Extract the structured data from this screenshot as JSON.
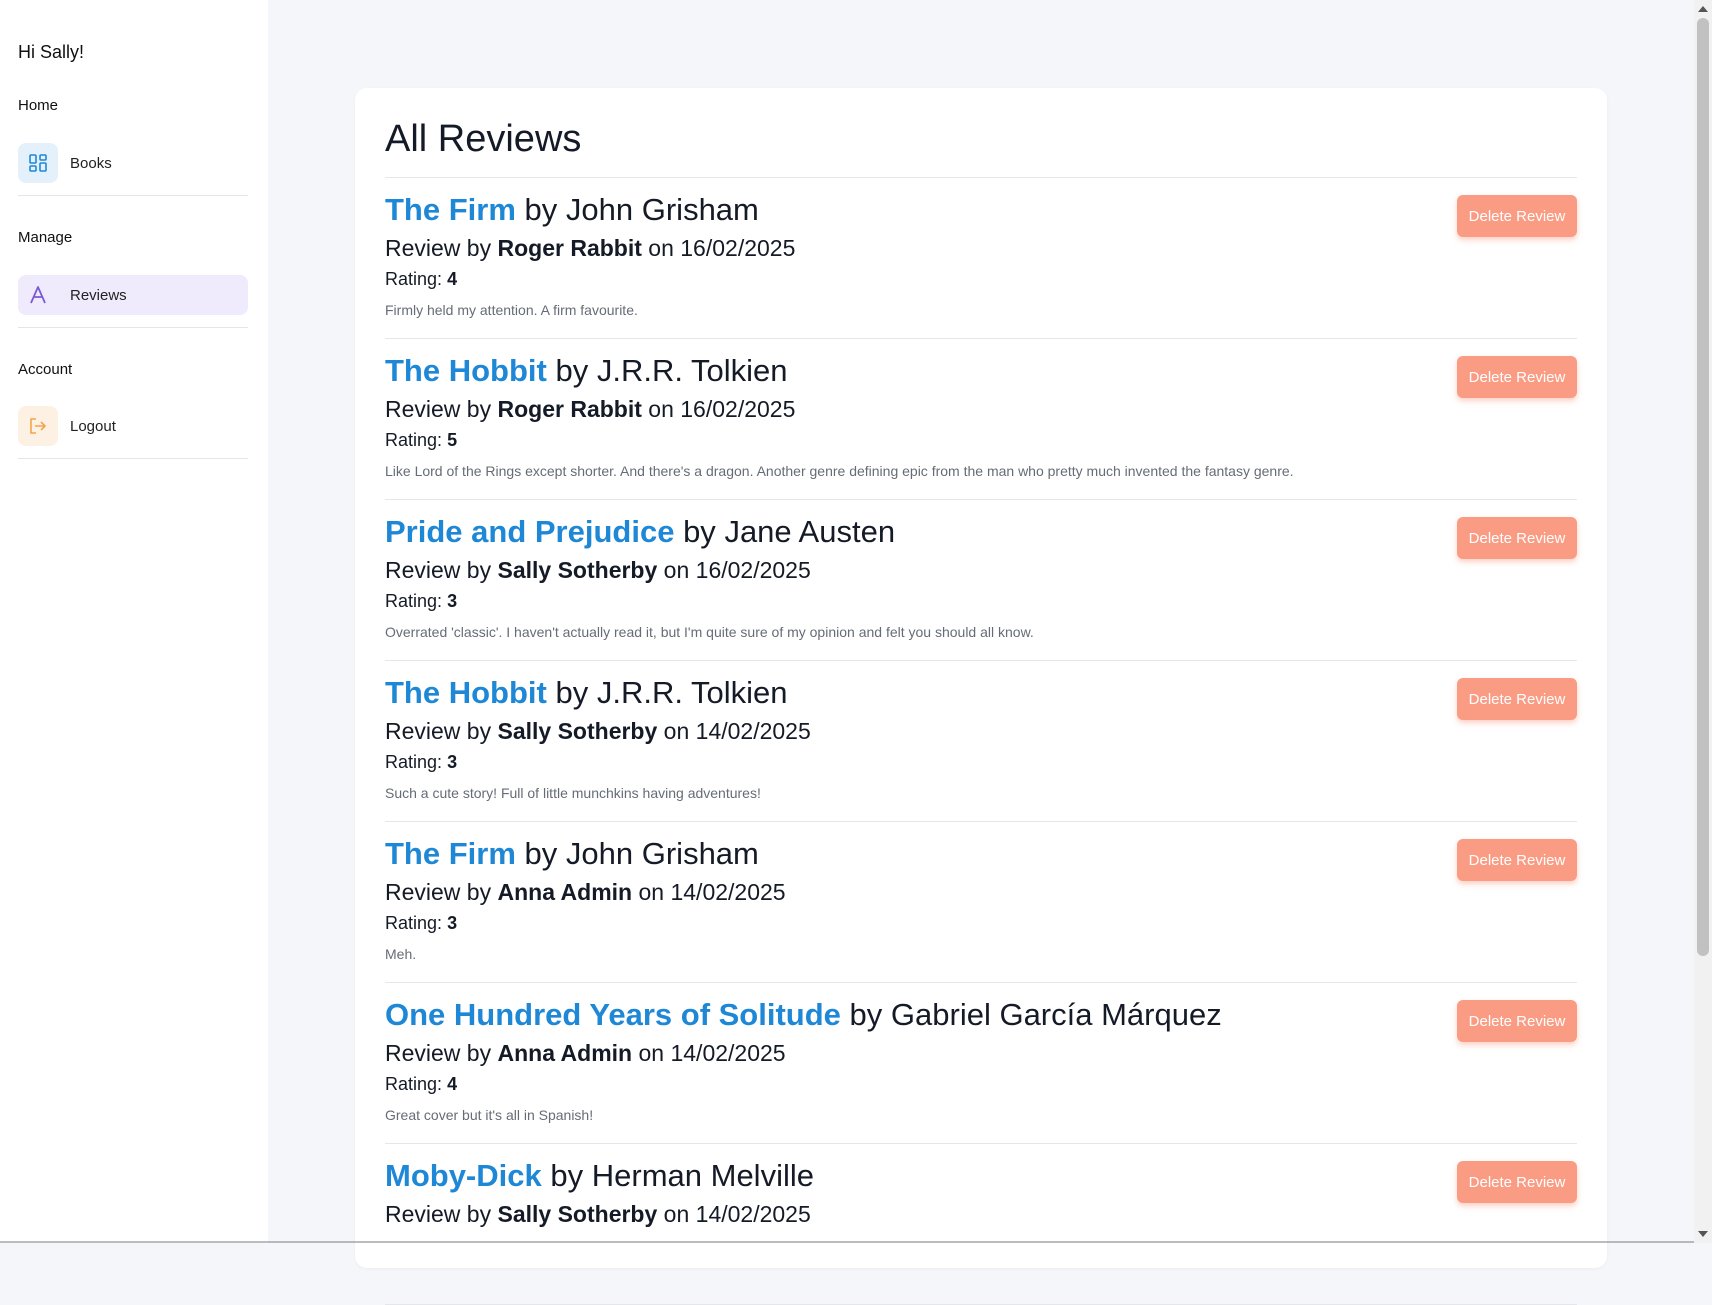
{
  "sidebar": {
    "greeting": "Hi Sally!",
    "home_label": "Home",
    "books_label": "Books",
    "manage_label": "Manage",
    "reviews_label": "Reviews",
    "account_label": "Account",
    "logout_label": "Logout",
    "icons": {
      "books": "dashboard-grid-icon",
      "reviews": "letter-a-icon",
      "logout": "logout-icon"
    }
  },
  "main": {
    "title": "All Reviews",
    "delete_label": "Delete Review",
    "review_by_prefix": "Review by",
    "on_word": "on",
    "rating_prefix": "Rating:",
    "by_word": "by",
    "reviews": [
      {
        "title": "The Firm",
        "author": "John Grisham",
        "reviewer": "Roger Rabbit",
        "date": "16/02/2025",
        "rating": "4",
        "text": "Firmly held my attention. A firm favourite."
      },
      {
        "title": "The Hobbit",
        "author": "J.R.R. Tolkien",
        "reviewer": "Roger Rabbit",
        "date": "16/02/2025",
        "rating": "5",
        "text": "Like Lord of the Rings except shorter. And there's a dragon. Another genre defining epic from the man who pretty much invented the fantasy genre."
      },
      {
        "title": "Pride and Prejudice",
        "author": "Jane Austen",
        "reviewer": "Sally Sotherby",
        "date": "16/02/2025",
        "rating": "3",
        "text": "Overrated 'classic'. I haven't actually read it, but I'm quite sure of my opinion and felt you should all know."
      },
      {
        "title": "The Hobbit",
        "author": "J.R.R. Tolkien",
        "reviewer": "Sally Sotherby",
        "date": "14/02/2025",
        "rating": "3",
        "text": "Such a cute story! Full of little munchkins having adventures!"
      },
      {
        "title": "The Firm",
        "author": "John Grisham",
        "reviewer": "Anna Admin",
        "date": "14/02/2025",
        "rating": "3",
        "text": "Meh."
      },
      {
        "title": "One Hundred Years of Solitude",
        "author": "Gabriel García Márquez",
        "reviewer": "Anna Admin",
        "date": "14/02/2025",
        "rating": "4",
        "text": "Great cover but it's all in Spanish!"
      },
      {
        "title": "Moby-Dick",
        "author": "Herman Melville",
        "reviewer": "Sally Sotherby",
        "date": "14/02/2025",
        "rating": "",
        "text": ""
      }
    ]
  },
  "colors": {
    "accent": "#1e88d6",
    "delete_button": "#fa9b83",
    "active_nav": "#efeafc"
  }
}
